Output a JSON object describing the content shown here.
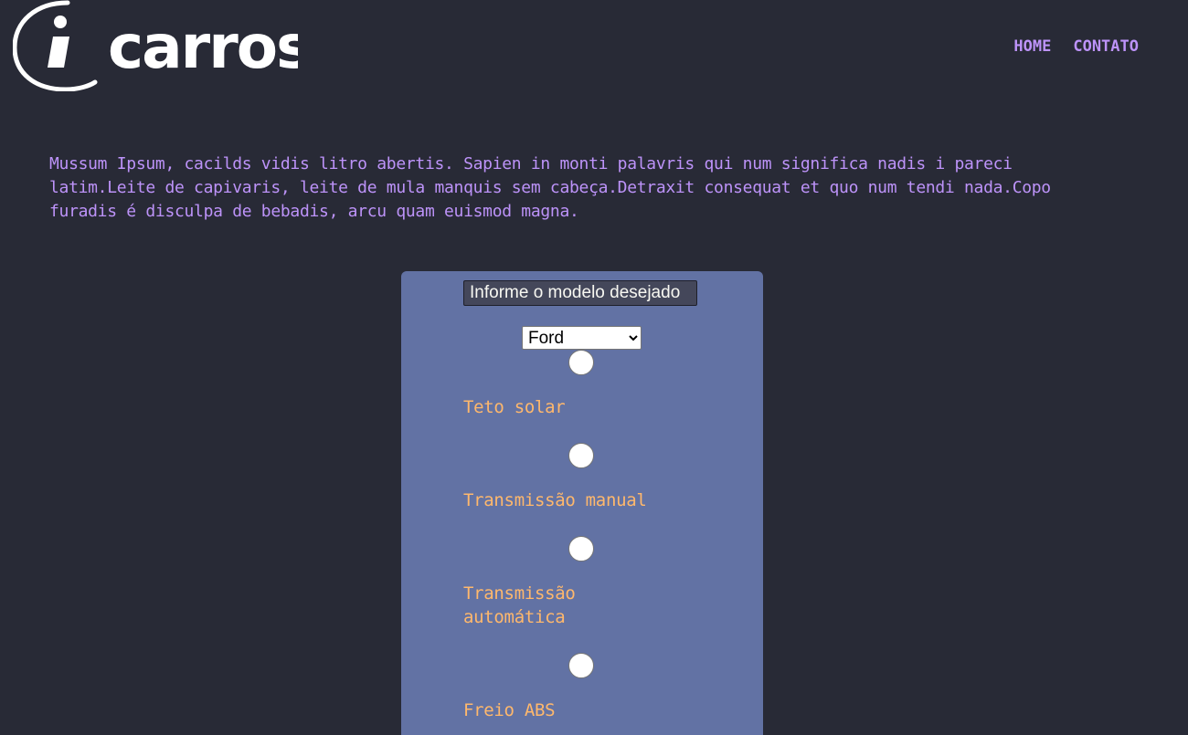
{
  "logo": {
    "text": "carros",
    "mark": "i",
    "colors": {
      "foreground": "#ffffff"
    }
  },
  "nav": {
    "items": [
      {
        "label": "HOME"
      },
      {
        "label": "CONTATO"
      }
    ]
  },
  "intro": {
    "text": "Mussum Ipsum, cacilds vidis litro abertis. Sapien in monti palavris qui num significa nadis i pareci latim.Leite de capivaris, leite de mula manquis sem cabeça.Detraxit consequat et quo num tendi nada.Copo furadis é disculpa de bebadis, arcu quam euismod magna."
  },
  "form": {
    "model_input": {
      "placeholder": "Informe o modelo desejado",
      "value": ""
    },
    "brand_select": {
      "selected": "Ford"
    },
    "options": [
      {
        "label": "Teto solar",
        "checked": false
      },
      {
        "label": "Transmissão manual",
        "checked": false
      },
      {
        "label": "Transmissão automática",
        "checked": false
      },
      {
        "label": "Freio ABS",
        "checked": false
      }
    ]
  },
  "colors": {
    "background": "#282a36",
    "accent": "#bd93f9",
    "panel": "#6272a4",
    "label": "#ffb86c"
  }
}
